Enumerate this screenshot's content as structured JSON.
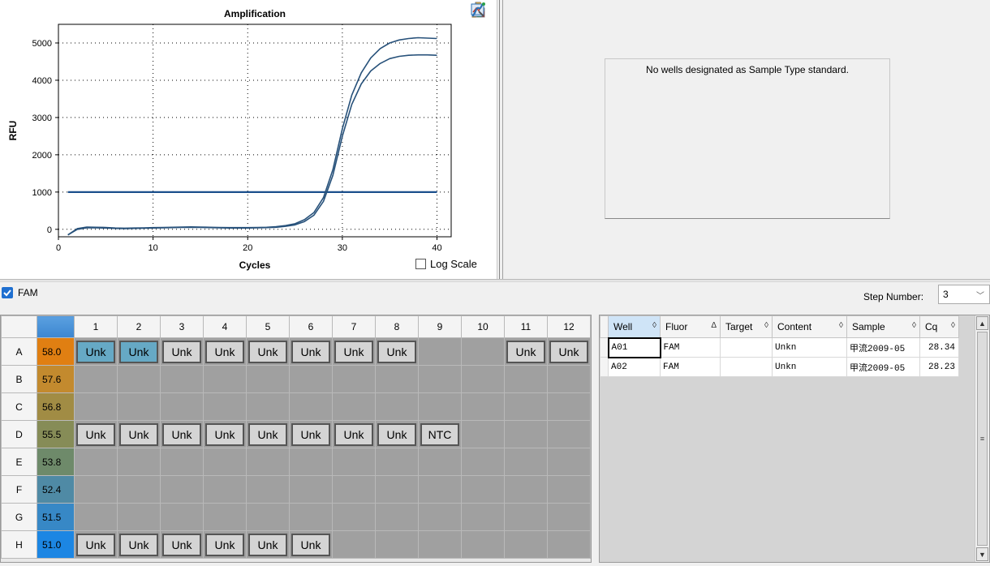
{
  "chart_data": {
    "type": "line",
    "title": "Amplification",
    "xlabel": "Cycles",
    "ylabel": "RFU",
    "xlim": [
      0,
      41.5
    ],
    "ylim": [
      -200,
      5500
    ],
    "xticks": [
      0,
      10,
      20,
      30,
      40
    ],
    "yticks": [
      0,
      1000,
      2000,
      3000,
      4000,
      5000
    ],
    "grid": true,
    "threshold": 1000,
    "series": [
      {
        "color": "#27517a",
        "x": [
          1,
          2,
          3,
          4,
          5,
          6,
          7,
          8,
          9,
          10,
          11,
          12,
          13,
          14,
          15,
          16,
          17,
          18,
          19,
          20,
          21,
          22,
          23,
          24,
          25,
          26,
          27,
          28,
          29,
          30,
          31,
          32,
          33,
          34,
          35,
          36,
          37,
          38,
          39,
          40
        ],
        "y": [
          -150,
          20,
          60,
          55,
          50,
          35,
          30,
          35,
          40,
          45,
          50,
          55,
          60,
          65,
          60,
          55,
          50,
          45,
          45,
          45,
          50,
          55,
          70,
          100,
          150,
          260,
          450,
          850,
          1600,
          2700,
          3600,
          4200,
          4600,
          4850,
          5000,
          5080,
          5120,
          5140,
          5130,
          5120
        ]
      },
      {
        "color": "#27517a",
        "x": [
          1,
          2,
          3,
          4,
          5,
          6,
          7,
          8,
          9,
          10,
          11,
          12,
          13,
          14,
          15,
          16,
          17,
          18,
          19,
          20,
          21,
          22,
          23,
          24,
          25,
          26,
          27,
          28,
          29,
          30,
          31,
          32,
          33,
          34,
          35,
          36,
          37,
          38,
          39,
          40
        ],
        "y": [
          -150,
          0,
          40,
          40,
          35,
          25,
          20,
          25,
          30,
          35,
          40,
          45,
          50,
          55,
          50,
          45,
          40,
          35,
          35,
          35,
          40,
          45,
          55,
          80,
          120,
          210,
          380,
          750,
          1450,
          2500,
          3350,
          3900,
          4250,
          4450,
          4580,
          4640,
          4670,
          4680,
          4680,
          4670
        ]
      }
    ]
  },
  "toolbar": {
    "icons": [
      "clipboard-icon",
      "chart-options-icon",
      "export-icon",
      "zoom-chart-icon",
      "curve-fit-icon"
    ]
  },
  "log_scale_label": "Log Scale",
  "std_curve": {
    "message": "No wells designated as Sample Type standard."
  },
  "filter": {
    "fluor_label": "FAM",
    "step_label": "Step Number:",
    "step_value": "3"
  },
  "plate": {
    "columns": [
      "1",
      "2",
      "3",
      "4",
      "5",
      "6",
      "7",
      "8",
      "9",
      "10",
      "11",
      "12"
    ],
    "rows": [
      {
        "label": "A",
        "temp": "58.0",
        "color": "#e07f12",
        "wells": [
          "Unk",
          "Unk",
          "Unk",
          "Unk",
          "Unk",
          "Unk",
          "Unk",
          "Unk",
          "",
          "",
          "Unk",
          "Unk"
        ],
        "selected": [
          0,
          1
        ]
      },
      {
        "label": "B",
        "temp": "57.6",
        "color": "#c38a2e",
        "wells": [
          "",
          "",
          "",
          "",
          "",
          "",
          "",
          "",
          "",
          "",
          "",
          ""
        ],
        "selected": []
      },
      {
        "label": "C",
        "temp": "56.8",
        "color": "#a18c44",
        "wells": [
          "",
          "",
          "",
          "",
          "",
          "",
          "",
          "",
          "",
          "",
          "",
          ""
        ],
        "selected": []
      },
      {
        "label": "D",
        "temp": "55.5",
        "color": "#868c57",
        "wells": [
          "Unk",
          "Unk",
          "Unk",
          "Unk",
          "Unk",
          "Unk",
          "Unk",
          "Unk",
          "NTC",
          "",
          "",
          ""
        ],
        "selected": []
      },
      {
        "label": "E",
        "temp": "53.8",
        "color": "#6e8a6a",
        "wells": [
          "",
          "",
          "",
          "",
          "",
          "",
          "",
          "",
          "",
          "",
          "",
          ""
        ],
        "selected": []
      },
      {
        "label": "F",
        "temp": "52.4",
        "color": "#4f8aa5",
        "wells": [
          "",
          "",
          "",
          "",
          "",
          "",
          "",
          "",
          "",
          "",
          "",
          ""
        ],
        "selected": []
      },
      {
        "label": "G",
        "temp": "51.5",
        "color": "#3788c6",
        "wells": [
          "",
          "",
          "",
          "",
          "",
          "",
          "",
          "",
          "",
          "",
          "",
          ""
        ],
        "selected": []
      },
      {
        "label": "H",
        "temp": "51.0",
        "color": "#1c86e3",
        "wells": [
          "Unk",
          "Unk",
          "Unk",
          "Unk",
          "Unk",
          "Unk",
          "",
          "",
          "",
          "",
          "",
          ""
        ],
        "selected": []
      }
    ]
  },
  "results": {
    "headers": [
      "Well",
      "Fluor",
      "Target",
      "Content",
      "Sample",
      "Cq"
    ],
    "sort_marks": [
      "◊",
      "Δ",
      "◊",
      "◊",
      "◊",
      "◊"
    ],
    "rows": [
      [
        "A01",
        "FAM",
        "",
        "Unkn",
        "甲流2009-05",
        "28.34"
      ],
      [
        "A02",
        "FAM",
        "",
        "Unkn",
        "甲流2009-05",
        "28.23"
      ]
    ]
  }
}
